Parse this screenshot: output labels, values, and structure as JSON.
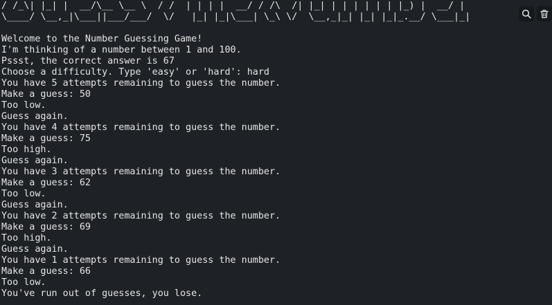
{
  "terminal": {
    "lines": [
      "/ /_\\| |_| |  __/\\__ \\__ \\  / /  | | | |  __/ / /\\  /| |_| | | | | | | |_) |  __/ |",
      "\\____/ \\__,_|\\___||___/___/  \\/   |_| |_|\\___| \\_\\ \\/  \\__,_|_| |_| |_|_.__/ \\___|_|",
      "",
      "Welcome to the Number Guessing Game!",
      "I'm thinking of a number between 1 and 100.",
      "Pssst, the correct answer is 67",
      "Choose a difficulty. Type 'easy' or 'hard': hard",
      "You have 5 attempts remaining to guess the number.",
      "Make a guess: 50",
      "Too low.",
      "Guess again.",
      "You have 4 attempts remaining to guess the number.",
      "Make a guess: 75",
      "Too high.",
      "Guess again.",
      "You have 3 attempts remaining to guess the number.",
      "Make a guess: 62",
      "Too low.",
      "Guess again.",
      "You have 2 attempts remaining to guess the number.",
      "Make a guess: 69",
      "Too high.",
      "Guess again.",
      "You have 1 attempts remaining to guess the number.",
      "Make a guess: 66",
      "Too low.",
      "You've run out of guesses, you lose."
    ]
  },
  "toolbar": {
    "buttons": [
      {
        "icon": "search-icon"
      },
      {
        "icon": "trash-icon"
      }
    ]
  },
  "colors": {
    "background": "#1e2126",
    "text": "#e6e6e6",
    "button_bg": "#15181c"
  }
}
